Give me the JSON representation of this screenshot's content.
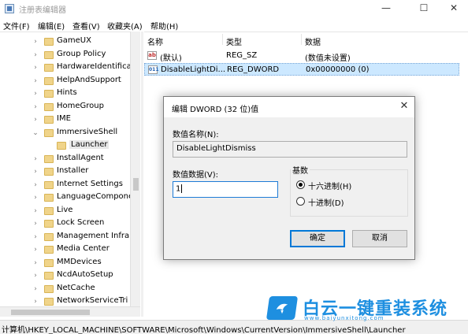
{
  "window": {
    "title": "注册表编辑器",
    "minimize": "—",
    "maximize": "☐",
    "close": "✕"
  },
  "menu": [
    "文件(F)",
    "编辑(E)",
    "查看(V)",
    "收藏夹(A)",
    "帮助(H)"
  ],
  "tree": {
    "items": [
      {
        "label": "GameUX",
        "arrow": "›",
        "selected": false,
        "indent": 1
      },
      {
        "label": "Group Policy",
        "arrow": "›",
        "selected": false,
        "indent": 1
      },
      {
        "label": "HardwareIdentifica",
        "arrow": "›",
        "selected": false,
        "indent": 1
      },
      {
        "label": "HelpAndSupport",
        "arrow": "›",
        "selected": false,
        "indent": 1
      },
      {
        "label": "Hints",
        "arrow": "›",
        "selected": false,
        "indent": 1
      },
      {
        "label": "HomeGroup",
        "arrow": "›",
        "selected": false,
        "indent": 1
      },
      {
        "label": "IME",
        "arrow": "›",
        "selected": false,
        "indent": 1
      },
      {
        "label": "ImmersiveShell",
        "arrow": "⌄",
        "selected": false,
        "indent": 1
      },
      {
        "label": "Launcher",
        "arrow": "",
        "selected": true,
        "indent": 2
      },
      {
        "label": "InstallAgent",
        "arrow": "›",
        "selected": false,
        "indent": 1
      },
      {
        "label": "Installer",
        "arrow": "›",
        "selected": false,
        "indent": 1
      },
      {
        "label": "Internet Settings",
        "arrow": "›",
        "selected": false,
        "indent": 1
      },
      {
        "label": "LanguageCompone",
        "arrow": "›",
        "selected": false,
        "indent": 1
      },
      {
        "label": "Live",
        "arrow": "›",
        "selected": false,
        "indent": 1
      },
      {
        "label": "Lock Screen",
        "arrow": "›",
        "selected": false,
        "indent": 1
      },
      {
        "label": "Management Infra",
        "arrow": "›",
        "selected": false,
        "indent": 1
      },
      {
        "label": "Media Center",
        "arrow": "›",
        "selected": false,
        "indent": 1
      },
      {
        "label": "MMDevices",
        "arrow": "›",
        "selected": false,
        "indent": 1
      },
      {
        "label": "NcdAutoSetup",
        "arrow": "›",
        "selected": false,
        "indent": 1
      },
      {
        "label": "NetCache",
        "arrow": "›",
        "selected": false,
        "indent": 1
      },
      {
        "label": "NetworkServiceTri",
        "arrow": "›",
        "selected": false,
        "indent": 1
      }
    ]
  },
  "values_pane": {
    "columns": [
      "名称",
      "类型",
      "数据"
    ],
    "rows": [
      {
        "icon": "ab",
        "name": "(默认)",
        "type": "REG_SZ",
        "data": "(数值未设置)",
        "selected": false
      },
      {
        "icon": "011",
        "name": "DisableLightDi...",
        "type": "REG_DWORD",
        "data": "0x00000000 (0)",
        "selected": true
      }
    ]
  },
  "dialog": {
    "title": "编辑 DWORD (32 位)值",
    "close": "✕",
    "name_label": "数值名称(N):",
    "name_value": "DisableLightDismiss",
    "data_label": "数值数据(V):",
    "data_value": "1",
    "base_label": "基数",
    "base_options": [
      {
        "label": "十六进制(H)",
        "checked": true
      },
      {
        "label": "十进制(D)",
        "checked": false
      }
    ],
    "ok_label": "确定",
    "cancel_label": "取消"
  },
  "status": {
    "path": "计算机\\HKEY_LOCAL_MACHINE\\SOFTWARE\\Microsoft\\Windows\\CurrentVersion\\ImmersiveShell\\Launcher"
  },
  "watermark": {
    "brand": "白云一键重装系统",
    "url": "www.baiyunxitong.com",
    "color": "#1e8fe0"
  },
  "colors": {
    "selection": "#cce8ff",
    "focus_border": "#0078d7",
    "folder": "#f0d48a"
  }
}
